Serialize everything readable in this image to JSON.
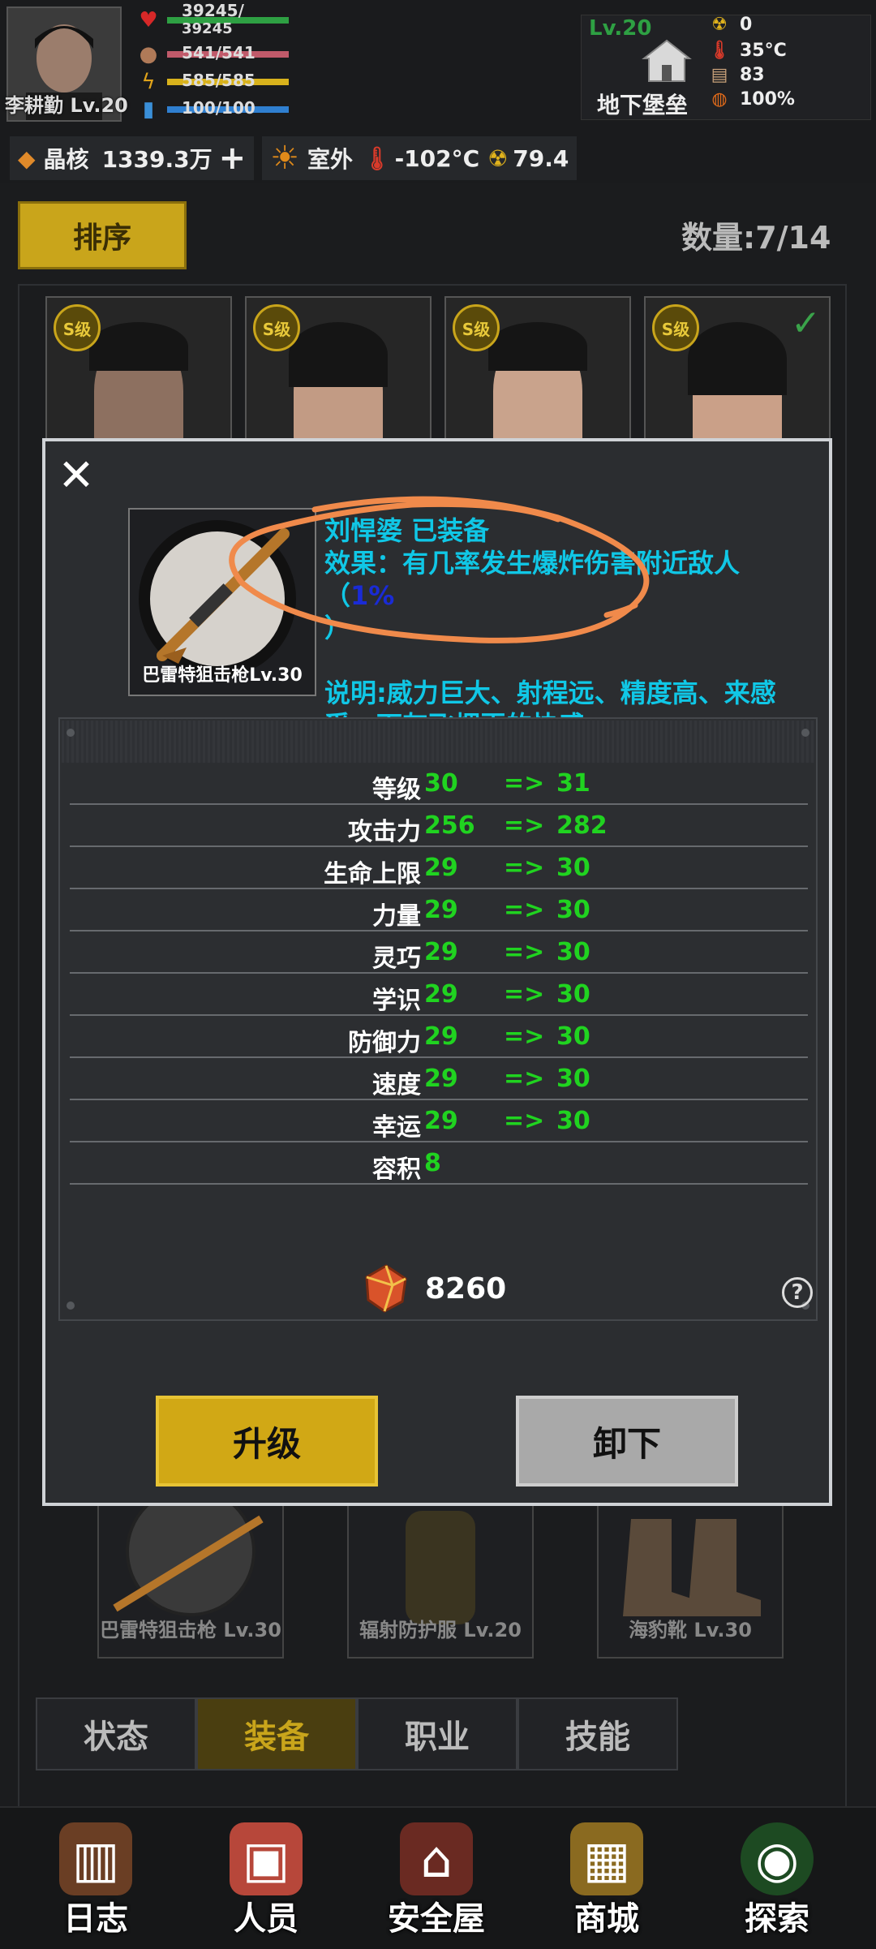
{
  "player": {
    "name": "李耕勤 Lv.20"
  },
  "stats": {
    "hp_top": "39245/",
    "hp_bottom": "39245",
    "food": "541/541",
    "energy": "585/585",
    "water": "100/100"
  },
  "base": {
    "level": "Lv.20",
    "name": "地下堡垒",
    "radiation": "0",
    "temperature": "35°C",
    "supplies": "83",
    "progress": "100%"
  },
  "resources": {
    "crystal_label": "晶核",
    "crystal_value": "1339.3万",
    "add_symbol": "+",
    "location_label": "室外",
    "outside_temp": "-102°C",
    "outside_radiation": "79.4"
  },
  "roster": {
    "sort_label": "排序",
    "count_label": "数量:7/14",
    "rank_label": "S级"
  },
  "modal": {
    "close_symbol": "✕",
    "item_caption": "巴雷特狙击枪Lv.30",
    "equipped_line": "刘悍婆 已装备",
    "effect_prefix": "效果：有几率发生爆炸伤害附近敌人（",
    "effect_pct": "1%",
    "effect_suffix": "）",
    "desc": "说明:威力巨大、射程远、精度高、来感受一下灰飞烟灭的快感",
    "rows": [
      {
        "label": "等级",
        "old": "30",
        "arrow": "=>",
        "new": "31"
      },
      {
        "label": "攻击力",
        "old": "256",
        "arrow": "=>",
        "new": "282"
      },
      {
        "label": "生命上限",
        "old": "29",
        "arrow": "=>",
        "new": "30"
      },
      {
        "label": "力量",
        "old": "29",
        "arrow": "=>",
        "new": "30"
      },
      {
        "label": "灵巧",
        "old": "29",
        "arrow": "=>",
        "new": "30"
      },
      {
        "label": "学识",
        "old": "29",
        "arrow": "=>",
        "new": "30"
      },
      {
        "label": "防御力",
        "old": "29",
        "arrow": "=>",
        "new": "30"
      },
      {
        "label": "速度",
        "old": "29",
        "arrow": "=>",
        "new": "30"
      },
      {
        "label": "幸运",
        "old": "29",
        "arrow": "=>",
        "new": "30"
      },
      {
        "label": "容积",
        "old": "8",
        "arrow": "",
        "new": ""
      }
    ],
    "cost": "8260",
    "help_symbol": "?",
    "upgrade_label": "升级",
    "unequip_label": "卸下"
  },
  "equipment": {
    "weapon": "巴雷特狙击枪 Lv.30",
    "armor": "辐射防护服 Lv.20",
    "boots": "海豹靴 Lv.30"
  },
  "tabs": [
    "状态",
    "装备",
    "职业",
    "技能"
  ],
  "nav": [
    "日志",
    "人员",
    "安全屋",
    "商城",
    "探索"
  ],
  "colors": {
    "accent_gold": "#c9a51b",
    "stat_green": "#20d320",
    "info_cyan": "#10c7e6",
    "annotation_orange": "#f08a4b"
  }
}
